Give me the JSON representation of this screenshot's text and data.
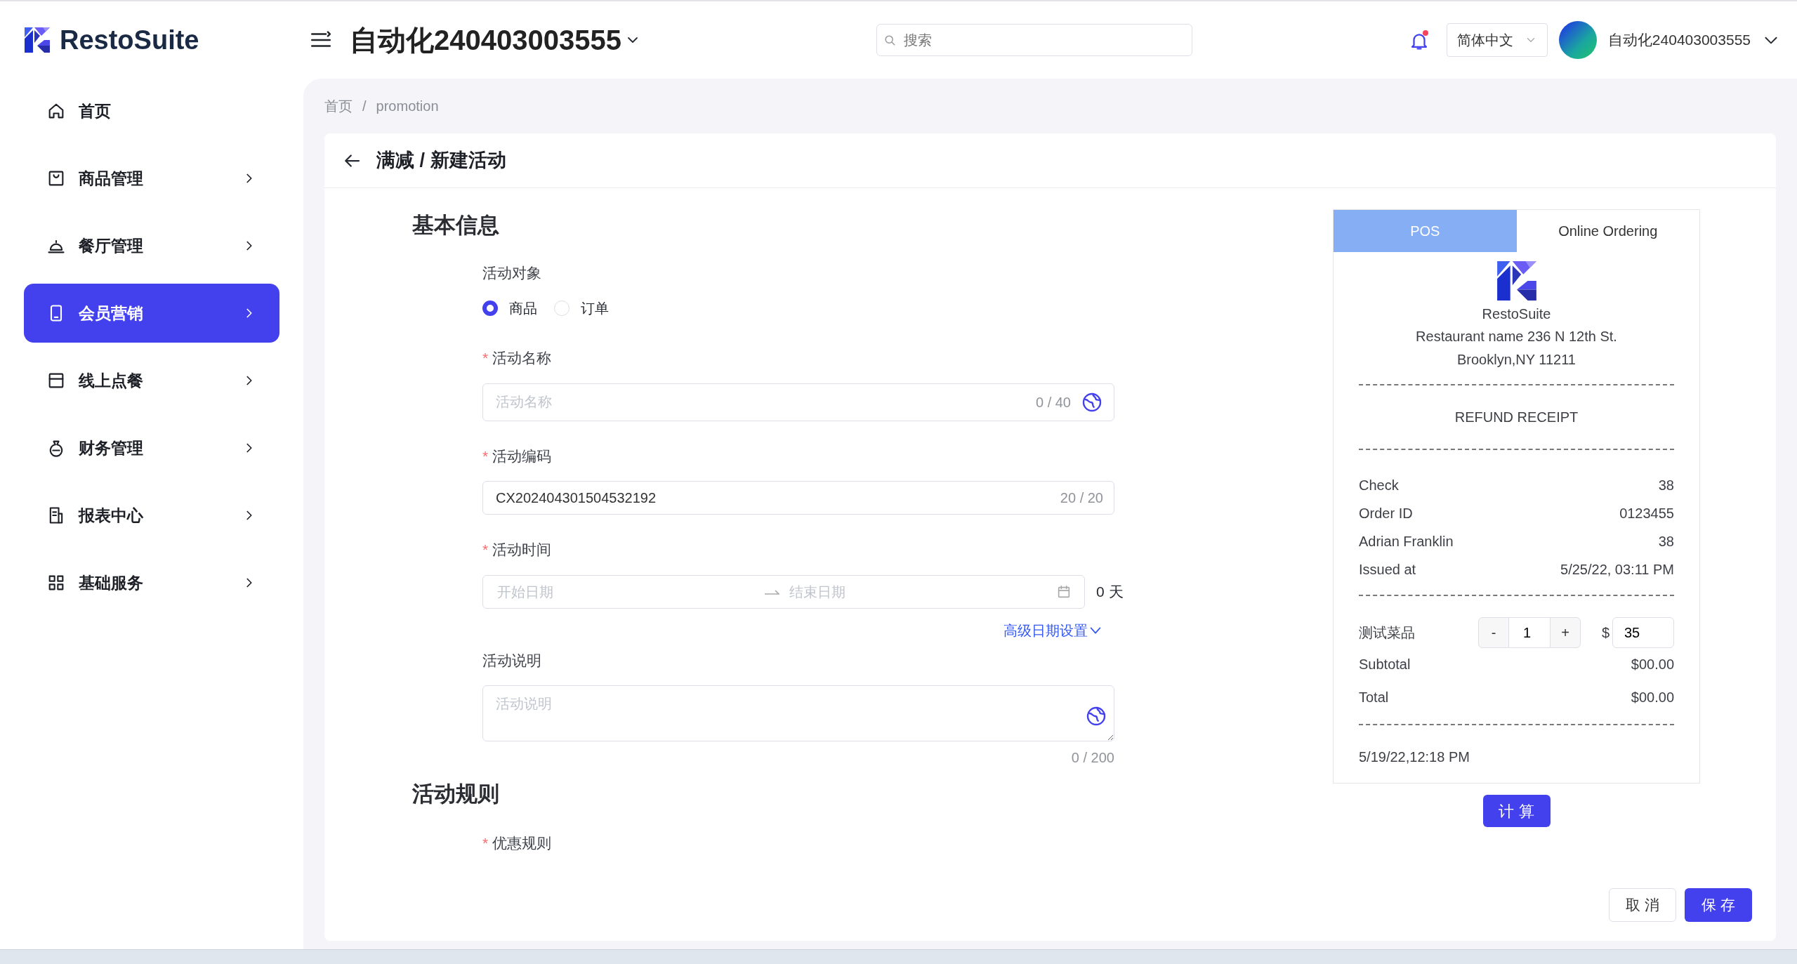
{
  "brand": "RestoSuite",
  "header": {
    "store": "自动化240403003555",
    "search_placeholder": "搜索",
    "notification_dot": true,
    "language": "简体中文",
    "user": "自动化240403003555"
  },
  "sidebar": {
    "items": [
      {
        "label": "首页",
        "expandable": false,
        "selected": false
      },
      {
        "label": "商品管理",
        "expandable": true,
        "selected": false
      },
      {
        "label": "餐厅管理",
        "expandable": true,
        "selected": false
      },
      {
        "label": "会员营销",
        "expandable": true,
        "selected": true
      },
      {
        "label": "线上点餐",
        "expandable": true,
        "selected": false
      },
      {
        "label": "财务管理",
        "expandable": true,
        "selected": false
      },
      {
        "label": "报表中心",
        "expandable": true,
        "selected": false
      },
      {
        "label": "基础服务",
        "expandable": true,
        "selected": false
      }
    ]
  },
  "breadcrumb": [
    "首页",
    "promotion"
  ],
  "breadcrumb_separator": "/",
  "required_mark": "*",
  "page_title": "满减 / 新建活动",
  "basic_info": {
    "title": "基本信息",
    "target": {
      "label": "活动对象",
      "options": [
        {
          "label": "商品",
          "selected": true
        },
        {
          "label": "订单",
          "selected": false
        }
      ]
    },
    "name": {
      "label": "活动名称",
      "required": true,
      "placeholder": "活动名称",
      "counter": "0 / 40"
    },
    "code": {
      "label": "活动编码",
      "required": true,
      "value": "CX202404301504532192",
      "counter": "20 / 20"
    },
    "time": {
      "label": "活动时间",
      "required": true,
      "start_placeholder": "开始日期",
      "end_placeholder": "结束日期",
      "days": "0 天",
      "advanced_link": "高级日期设置"
    },
    "description": {
      "label": "活动说明",
      "required": false,
      "placeholder": "活动说明",
      "counter": "0 / 200"
    }
  },
  "rules": {
    "title": "活动规则",
    "fields": [
      {
        "label": "优惠规则",
        "required": true
      }
    ]
  },
  "preview": {
    "tabs": [
      {
        "label": "POS",
        "selected": true
      },
      {
        "label": "Online Ordering",
        "selected": false
      }
    ],
    "brand": "RestoSuite",
    "address_lines": [
      "Restaurant name 236 N 12th St.",
      "Brooklyn,NY 11211"
    ],
    "receipt_title": "REFUND RECEIPT",
    "info_rows": [
      {
        "label": "Check",
        "value": "38"
      },
      {
        "label": "Order ID",
        "value": "0123455"
      },
      {
        "label": "Adrian Franklin",
        "value": "38"
      },
      {
        "label": "Issued at",
        "value": "5/25/22, 03:11 PM"
      }
    ],
    "item": {
      "name": "测试菜品",
      "minus": "-",
      "quantity": "1",
      "plus": "+",
      "currency": "$",
      "price": "35"
    },
    "totals": [
      {
        "label": "Subtotal",
        "value": "$00.00"
      },
      {
        "label": "Total",
        "value": "$00.00"
      }
    ],
    "timestamp": "5/19/22,12:18 PM",
    "calc_button": "计 算"
  },
  "footer": {
    "buttons": [
      {
        "label": "取 消",
        "kind": "secondary"
      },
      {
        "label": "保 存",
        "kind": "primary"
      }
    ]
  }
}
